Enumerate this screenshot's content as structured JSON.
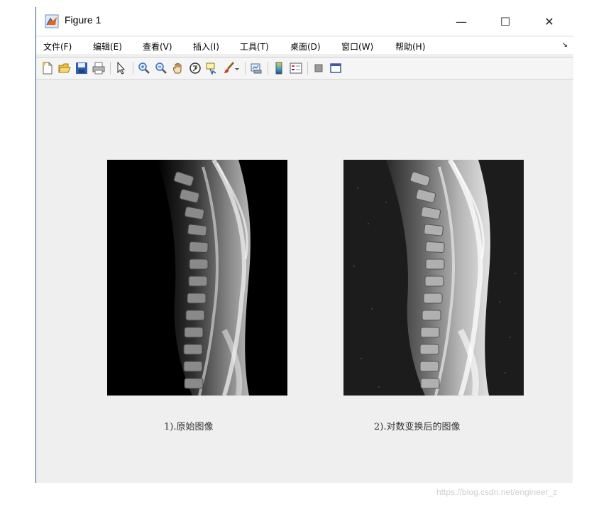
{
  "window": {
    "title": "Figure 1",
    "minimize_label": "—",
    "maximize_label": "☐",
    "close_label": "✕"
  },
  "menu": [
    {
      "label": "文件(F)"
    },
    {
      "label": "编辑(E)"
    },
    {
      "label": "查看(V)"
    },
    {
      "label": "插入(I)"
    },
    {
      "label": "工具(T)"
    },
    {
      "label": "桌面(D)"
    },
    {
      "label": "窗口(W)"
    },
    {
      "label": "帮助(H)"
    }
  ],
  "menu_overflow_label": "↘",
  "toolbar": [
    "new-figure-icon",
    "open-file-icon",
    "save-icon",
    "print-icon",
    "select-pointer-icon",
    "zoom-in-icon",
    "zoom-out-icon",
    "pan-hand-icon",
    "rotate-3d-icon",
    "data-cursor-icon",
    "brush-icon",
    "link-plot-icon",
    "colorbar-icon",
    "legend-icon",
    "hide-plot-tools-icon",
    "show-plot-tools-icon"
  ],
  "images": [
    {
      "caption": "1).原始图像",
      "background": "#000000"
    },
    {
      "caption": "2).对数变换后的图像",
      "background": "#1c1c1c"
    }
  ],
  "colors": {
    "figure_background": "#efefef",
    "title_bar": "#ffffff",
    "toolbar": "#f5f5f5",
    "window_border": "#2b5797"
  },
  "watermark": "https://blog.csdn.net/engineer_z"
}
